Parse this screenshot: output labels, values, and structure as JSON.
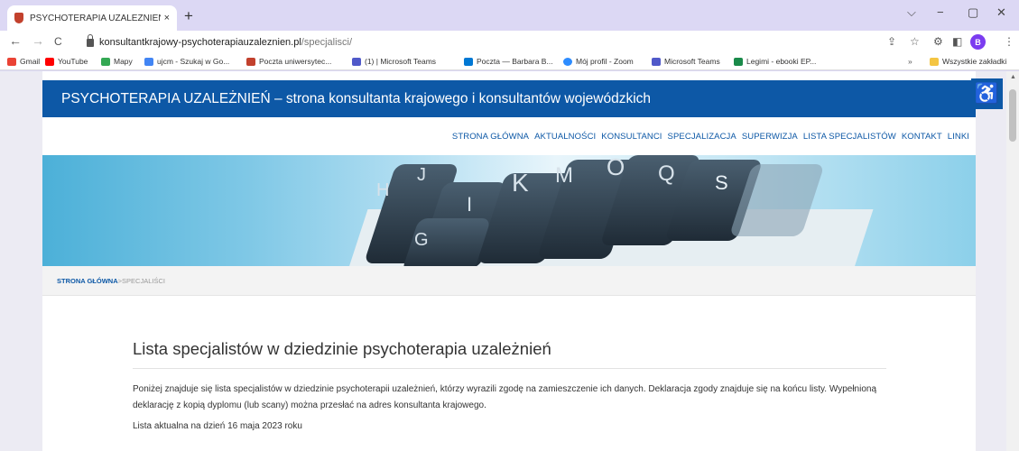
{
  "tab": {
    "title": "PSYCHOTERAPIA UZALEŻNIEŃ –",
    "close": "×",
    "new": "+"
  },
  "window": {
    "minimize": "−",
    "maximize": "▢",
    "close": "✕",
    "dropdown": "⌵"
  },
  "toolbar": {
    "back": "←",
    "forward": "→",
    "reload": "C",
    "url_host": "konsultantkrajowy-psychoterapiauzaleznien.pl",
    "url_path": "/specjalisci/",
    "profile_initial": "B"
  },
  "bookmarks": [
    {
      "label": "Gmail",
      "color": "#ea4335"
    },
    {
      "label": "YouTube",
      "color": "#ff0000"
    },
    {
      "label": "Mapy",
      "color": "#34a853"
    },
    {
      "label": "ujcm - Szukaj w Go...",
      "color": "#4285f4"
    },
    {
      "label": "Poczta uniwersytec...",
      "color": "#c2412d"
    },
    {
      "label": "(1) | Microsoft Teams",
      "color": "#5059c9"
    },
    {
      "label": "Poczta — Barbara B...",
      "color": "#0078d4"
    },
    {
      "label": "Mój profil - Zoom",
      "color": "#2d8cff"
    },
    {
      "label": "Microsoft Teams",
      "color": "#5059c9"
    },
    {
      "label": "Legimi - ebooki EP...",
      "color": "#1a8a4a"
    },
    {
      "label": "Wszystkie zakładki",
      "color": "#f4c542"
    }
  ],
  "bookmarks_more": "»",
  "site": {
    "title": "PSYCHOTERAPIA UZALEŻNIEŃ – strona konsultanta krajowego i konsultantów wojewódzkich",
    "nav": [
      "STRONA GŁÓWNA",
      "AKTUALNOŚCI",
      "KONSULTANCI",
      "SPECJALIZACJA",
      "SUPERWIZJA",
      "LISTA SPECJALISTÓW",
      "KONTAKT",
      "LINKI"
    ],
    "breadcrumb": {
      "home": "STRONA GŁÓWNA",
      "sep": " > ",
      "current": "SPECJALIŚCI"
    },
    "heading": "Lista specjalistów w dziedzinie psychoterapia uzależnień",
    "intro": "Poniżej znajduje się lista specjalistów w dziedzinie psychoterapii uzależnień, którzy wyrazili zgodę na zamieszczenie ich danych. Deklaracja zgody znajduje się na końcu listy. Wypełnioną deklarację z kopią dyplomu (lub scany) można przesłać na adres konsultanta krajowego.",
    "date_note": "Lista aktualna na dzień 16 maja 2023 roku",
    "banner_letters": [
      "H",
      "J",
      "I",
      "K",
      "M",
      "O",
      "Q",
      "S",
      "G"
    ]
  },
  "colors": {
    "brand": "#0d58a6",
    "chrome": "#dcd8f4"
  }
}
